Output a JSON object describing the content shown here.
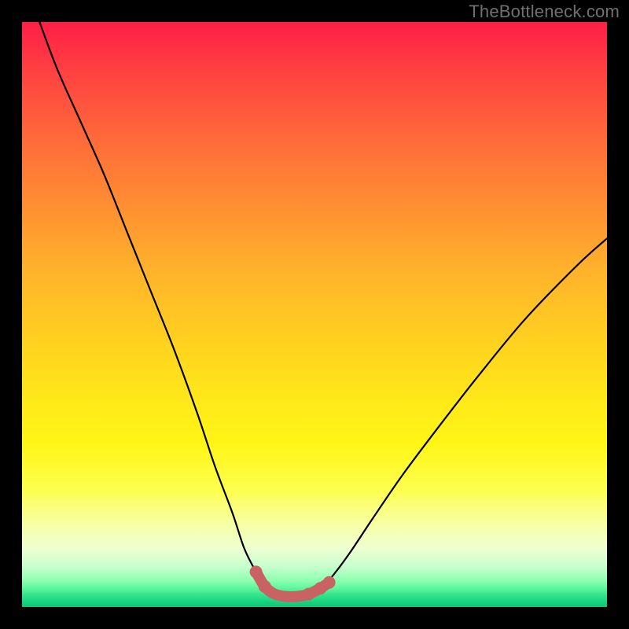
{
  "watermark": "TheBottleneck.com",
  "colors": {
    "page_bg": "#000000",
    "curve_stroke": "#000000",
    "bump_stroke": "#c96262",
    "gradient_top": "#ff1e46",
    "gradient_bottom": "#0fc676"
  },
  "chart_data": {
    "type": "line",
    "title": "",
    "xlabel": "",
    "ylabel": "",
    "xlim": [
      0,
      100
    ],
    "ylim": [
      0,
      100
    ],
    "grid": false,
    "legend": false,
    "series": [
      {
        "name": "bottleneck-curve",
        "x": [
          3,
          6,
          10,
          14,
          18,
          22,
          26,
          30,
          33,
          36,
          38,
          40,
          41.5,
          43,
          45,
          47,
          49,
          51,
          53,
          56,
          60,
          65,
          71,
          78,
          86,
          95,
          100
        ],
        "y": [
          100,
          92,
          83,
          74,
          64,
          54,
          44,
          33,
          24,
          16,
          10,
          6,
          3.5,
          2.3,
          1.8,
          1.8,
          2.2,
          3.2,
          5.2,
          9.2,
          15.2,
          22.5,
          30.5,
          39.5,
          49.2,
          58.5,
          63
        ]
      },
      {
        "name": "optimal-region",
        "x": [
          40,
          41.5,
          43,
          45,
          47,
          49,
          51,
          52.5
        ],
        "y": [
          6.0,
          3.5,
          2.3,
          1.8,
          1.8,
          2.2,
          3.2,
          4.2
        ]
      }
    ],
    "annotations": []
  }
}
